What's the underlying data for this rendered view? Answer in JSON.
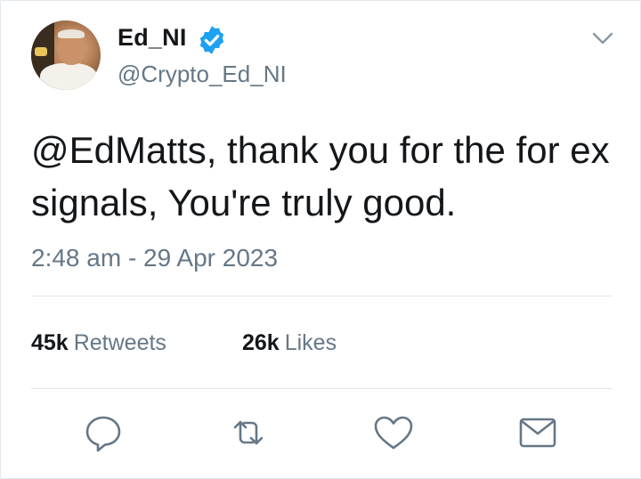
{
  "user": {
    "display_name": "Ed_NI",
    "handle": "@Crypto_Ed_NI",
    "verified": true
  },
  "tweet": {
    "text": "@EdMatts, thank you for the for ex signals, You're truly good.",
    "timestamp": "2:48 am - 29 Apr 2023"
  },
  "stats": {
    "retweets_count": "45k",
    "retweets_label": "Retweets",
    "likes_count": "26k",
    "likes_label": "Likes"
  },
  "icons": {
    "verified": "verified-badge-icon",
    "menu": "chevron-down-icon",
    "reply": "reply-icon",
    "retweet": "retweet-icon",
    "like": "heart-icon",
    "share": "envelope-icon"
  },
  "colors": {
    "verified_blue": "#1da1f2",
    "secondary_text": "#657786",
    "icon_gray": "#657786",
    "divider": "#e1e8ed"
  }
}
